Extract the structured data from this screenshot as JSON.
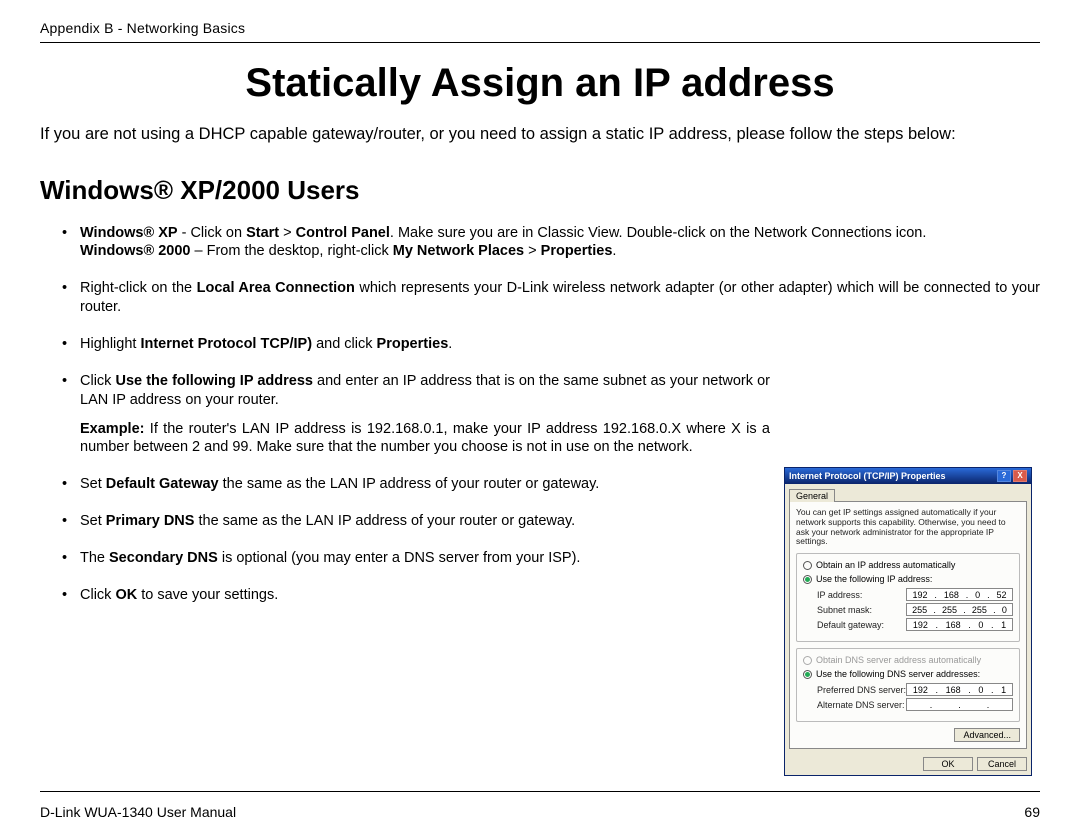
{
  "header": {
    "breadcrumb": "Appendix B - Networking Basics"
  },
  "title": "Statically Assign an IP address",
  "intro": "If you are not using a DHCP capable gateway/router, or you need to assign a static IP address, please follow the steps below:",
  "section": "Windows® XP/2000 Users",
  "bullets": {
    "b1_xp_pre": "Windows® XP",
    "b1_xp_mid": " - Click on ",
    "b1_xp_b1": "Start",
    "b1_xp_gt": " > ",
    "b1_xp_b2": "Control Panel",
    "b1_xp_post": ". Make sure you are in Classic View. Double-click on the Network Connections icon.",
    "b1_2000_pre": "Windows® 2000",
    "b1_2000_mid": " – From the desktop, right-click ",
    "b1_2000_b1": "My Network Places",
    "b1_2000_gt": " > ",
    "b1_2000_b2": "Properties",
    "b1_2000_post": ".",
    "b2_pre": "Right-click on the ",
    "b2_b": "Local Area Connection",
    "b2_post": " which represents your D-Link wireless network adapter (or other adapter) which will be connected to your router.",
    "b3_pre": "Highlight ",
    "b3_b1": "Internet Protocol TCP/IP)",
    "b3_mid": " and click ",
    "b3_b2": "Properties",
    "b3_post": ".",
    "b4_pre": "Click ",
    "b4_b": "Use the following IP address",
    "b4_post": " and enter an IP address that is on the same subnet as your network or LAN IP address on your router.",
    "b4_ex_b": "Example:",
    "b4_ex": " If the router's LAN IP address is 192.168.0.1, make your IP address 192.168.0.X where X is a number between 2 and 99. Make sure that the number you choose is not in use on the network.",
    "b5_pre": "Set ",
    "b5_b": "Default Gateway",
    "b5_post": " the same as the LAN IP address of your router or gateway.",
    "b6_pre": "Set ",
    "b6_b": "Primary DNS",
    "b6_post": " the same as the LAN IP address of your router or gateway.",
    "b7_pre": "The ",
    "b7_b": "Secondary DNS",
    "b7_post": " is optional (you may enter a DNS server from your ISP).",
    "b8_pre": "Click ",
    "b8_b": "OK",
    "b8_post": " to save your settings."
  },
  "dialog": {
    "title": "Internet Protocol (TCP/IP) Properties",
    "tab": "General",
    "desc": "You can get IP settings assigned automatically if your network supports this capability. Otherwise, you need to ask your network administrator for the appropriate IP settings.",
    "radio_auto_ip": "Obtain an IP address automatically",
    "radio_use_ip": "Use the following IP address:",
    "lbl_ip": "IP address:",
    "lbl_subnet": "Subnet mask:",
    "lbl_gateway": "Default gateway:",
    "radio_auto_dns": "Obtain DNS server address automatically",
    "radio_use_dns": "Use the following DNS server addresses:",
    "lbl_pref_dns": "Preferred DNS server:",
    "lbl_alt_dns": "Alternate DNS server:",
    "ip": [
      "192",
      "168",
      "0",
      "52"
    ],
    "subnet": [
      "255",
      "255",
      "255",
      "0"
    ],
    "gateway": [
      "192",
      "168",
      "0",
      "1"
    ],
    "pref_dns": [
      "192",
      "168",
      "0",
      "1"
    ],
    "btn_advanced": "Advanced...",
    "btn_ok": "OK",
    "btn_cancel": "Cancel",
    "help": "?",
    "close": "X"
  },
  "footer": {
    "left": "D-Link WUA-1340 User Manual",
    "right": "69"
  }
}
